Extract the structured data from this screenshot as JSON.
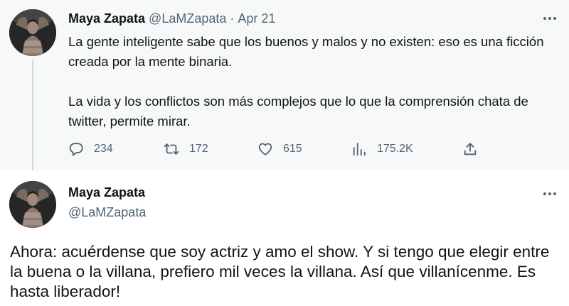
{
  "colors": {
    "primary_text": "#0f1419",
    "secondary_text": "#536471",
    "parent_tweet_background": "#f7f9f9",
    "thread_line": "#cfd9de"
  },
  "parent_tweet": {
    "author_name": "Maya Zapata",
    "author_handle": "@LaMZapata",
    "separator": "·",
    "date": "Apr 21",
    "paragraphs": [
      "La gente inteligente sabe que los buenos y malos y no existen: eso es una ficción creada por la mente binaria.",
      "La vida y los conflictos son más complejos que lo que la comprensión chata de twitter, permite mirar."
    ],
    "actions": {
      "replies": "234",
      "retweets": "172",
      "likes": "615",
      "views": "175.2K"
    },
    "icons": [
      "reply-icon",
      "retweet-icon",
      "like-icon",
      "views-icon",
      "share-icon",
      "more-icon"
    ]
  },
  "main_tweet": {
    "author_name": "Maya Zapata",
    "author_handle": "@LaMZapata",
    "text": "Ahora: acuérdense que soy actriz y amo el show. Y si tengo que elegir entre la buena o la villana, prefiero mil veces la villana. Así que villanícenme. Es hasta liberador!",
    "icons": [
      "more-icon"
    ]
  }
}
